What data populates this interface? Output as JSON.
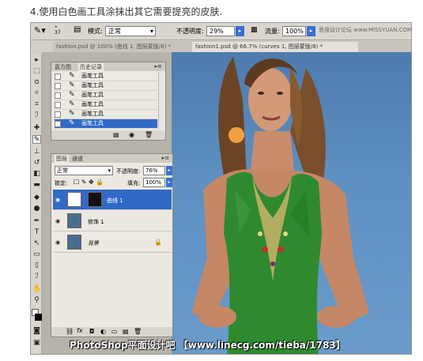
{
  "caption": "4.使用白色画工具涂抹出其它需要提亮的皮肤.",
  "options_bar": {
    "brush_size": "37",
    "mode_label": "模式:",
    "mode_value": "正常",
    "opacity_label": "不透明度:",
    "opacity_value": "29%",
    "flow_label": "流量:",
    "flow_value": "100%",
    "logo": "思缘设计论坛 www.MISSYUAN.COM"
  },
  "doc_tabs": [
    "fashion.psd @ 100% (曲线 1, 图层蒙版/8) *",
    "fashion1.psd @ 66.7% (curves 1, 图层蒙版/8) *"
  ],
  "history_panel": {
    "tabs": [
      "直方图",
      "历史记录"
    ],
    "rows": [
      "画笔工具",
      "画笔工具",
      "画笔工具",
      "画笔工具",
      "画笔工具",
      "画笔工具"
    ],
    "selected_index": 5
  },
  "layers_panel": {
    "tabs": [
      "图层",
      "通道"
    ],
    "blend_mode": "正常",
    "opacity_label": "不透明度:",
    "opacity_value": "76%",
    "lock_label": "锁定:",
    "fill_label": "填充:",
    "fill_value": "100%",
    "layers": [
      {
        "name": "曲线 1",
        "selected": true
      },
      {
        "name": "修饰 1",
        "selected": false
      },
      {
        "name": "背景",
        "selected": false
      }
    ]
  },
  "watermark": "PhotoShop平面设计吧 【www.linecg.com/tieba/1783】",
  "colors": {
    "selection": "#3169c6",
    "dress": "#2f8a2f",
    "background": "#5d8fc1"
  }
}
